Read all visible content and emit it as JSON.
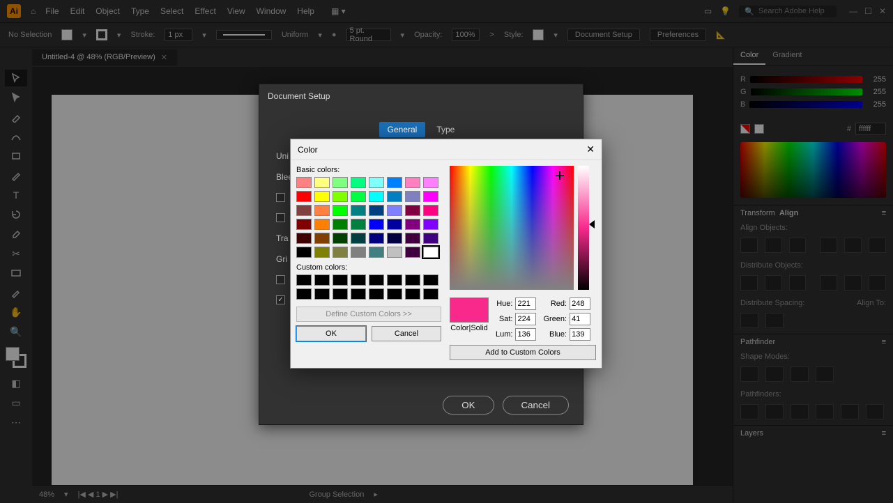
{
  "app": {
    "icon_text": "Ai"
  },
  "menu": {
    "items": [
      "File",
      "Edit",
      "Object",
      "Type",
      "Select",
      "Effect",
      "View",
      "Window",
      "Help"
    ]
  },
  "search": {
    "placeholder": "Search Adobe Help"
  },
  "options_bar": {
    "selection": "No Selection",
    "stroke_label": "Stroke:",
    "stroke_val": "1 px",
    "stroke_style": "Uniform",
    "brush": "5 pt. Round",
    "opacity_label": "Opacity:",
    "opacity_val": "100%",
    "style_label": "Style:",
    "doc_setup": "Document Setup",
    "preferences": "Preferences"
  },
  "document_tab": {
    "title": "Untitled-4 @ 48% (RGB/Preview)"
  },
  "statusbar": {
    "zoom": "48%",
    "page": "1",
    "tool": "Group Selection"
  },
  "right_panel": {
    "tabs": {
      "color": "Color",
      "gradient": "Gradient"
    },
    "rgb": {
      "r_label": "R",
      "g_label": "G",
      "b_label": "B",
      "r": "255",
      "g": "255",
      "b": "255"
    },
    "hex": "ffffff",
    "transform_tab": "Transform",
    "align_tab": "Align",
    "align_objects": "Align Objects:",
    "distribute_objects": "Distribute Objects:",
    "distribute_spacing": "Distribute Spacing:",
    "align_to": "Align To:",
    "pathfinder": "Pathfinder",
    "shape_modes": "Shape Modes:",
    "pathfinders": "Pathfinders:",
    "layers": "Layers"
  },
  "doc_setup": {
    "title": "Document Setup",
    "tabs": {
      "general": "General",
      "type": "Type"
    },
    "units_label": "Uni",
    "bleed_label": "Blee",
    "transp_label": "Tra",
    "grid_label": "Gri",
    "ok": "OK",
    "cancel": "Cancel"
  },
  "color_picker": {
    "title": "Color",
    "basic_label": "Basic colors:",
    "custom_label": "Custom colors:",
    "define": "Define Custom Colors >>",
    "ok": "OK",
    "cancel": "Cancel",
    "preview_label": "Color|Solid",
    "hue_label": "Hue:",
    "sat_label": "Sat:",
    "lum_label": "Lum:",
    "red_label": "Red:",
    "green_label": "Green:",
    "blue_label": "Blue:",
    "hue": "221",
    "sat": "224",
    "lum": "136",
    "red": "248",
    "green": "41",
    "blue": "139",
    "add": "Add to Custom Colors",
    "basic_colors": [
      "#ff8080",
      "#ffff80",
      "#80ff80",
      "#00ff80",
      "#80ffff",
      "#0080ff",
      "#ff80c0",
      "#ff80ff",
      "#ff0000",
      "#ffff00",
      "#80ff00",
      "#00ff40",
      "#00ffff",
      "#0080c0",
      "#8080c0",
      "#ff00ff",
      "#804040",
      "#ff8040",
      "#00ff00",
      "#008080",
      "#004080",
      "#8080ff",
      "#800040",
      "#ff0080",
      "#800000",
      "#ff8000",
      "#008000",
      "#008040",
      "#0000ff",
      "#0000a0",
      "#800080",
      "#8000ff",
      "#400000",
      "#804000",
      "#004000",
      "#004040",
      "#000080",
      "#000040",
      "#400040",
      "#400080",
      "#000000",
      "#808000",
      "#808040",
      "#808080",
      "#408080",
      "#c0c0c0",
      "#400040",
      "#ffffff"
    ]
  }
}
